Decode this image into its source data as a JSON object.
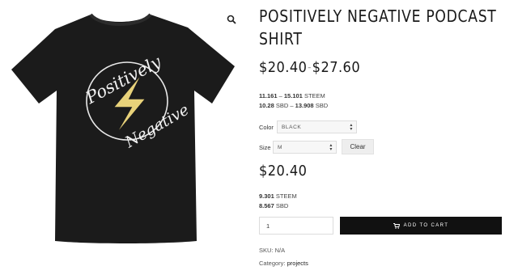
{
  "product": {
    "title": "POSITIVELY NEGATIVE PODCAST SHIRT",
    "price_min": "$20.40",
    "price_sep": "–",
    "price_max": "$27.60",
    "steem_range": {
      "low": "11.161",
      "sep": "–",
      "high": "15.101",
      "unit": "STEEM"
    },
    "sbd_range": {
      "low": "10.28",
      "unit_low": "SBD",
      "sep": "–",
      "high": "13.908",
      "unit": "SBD"
    },
    "variations": {
      "color_label": "Color",
      "color_value": "BLACK",
      "size_label": "Size",
      "size_value": "M",
      "clear_label": "Clear"
    },
    "selected_price": "$20.40",
    "selected_steem": {
      "value": "9.301",
      "unit": "STEEM"
    },
    "selected_sbd": {
      "value": "8.567",
      "unit": "SBD"
    },
    "quantity": "1",
    "add_to_cart": "ADD TO CART",
    "sku_label": "SKU:",
    "sku_value": "N/A",
    "category_label": "Category:",
    "category_value": "projects"
  },
  "image": {
    "shirt_color": "#1b1b1b",
    "logo_text_top": "Positively",
    "logo_text_bottom": "Negative",
    "bolt_color": "#e8d27a"
  },
  "icons": {
    "zoom": "magnifier-icon",
    "cart": "cart-icon"
  }
}
